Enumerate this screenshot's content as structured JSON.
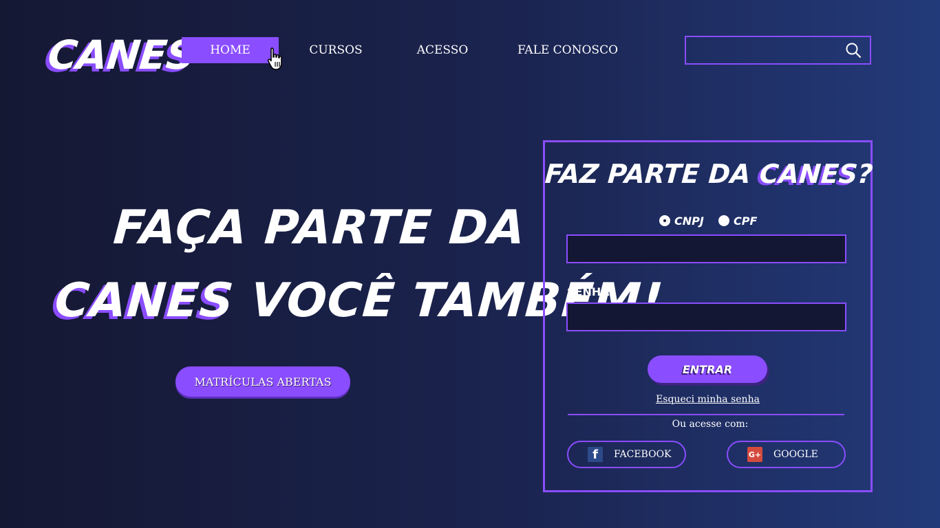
{
  "brand": {
    "logo": "CANES"
  },
  "nav": {
    "items": [
      {
        "label": "HOME",
        "active": true
      },
      {
        "label": "CURSOS"
      },
      {
        "label": "ACESSO"
      },
      {
        "label": "FALE CONOSCO"
      }
    ]
  },
  "search": {
    "value": "",
    "icon": "search-icon"
  },
  "hero": {
    "line1": "FAÇA PARTE DA",
    "brand_word": "CANES",
    "line2_rest": " VOCÊ TAMBÉM!",
    "cta_label": "MATRÍCULAS ABERTAS"
  },
  "login": {
    "title_prefix": "FAZ PARTE DA ",
    "title_brand": "CANES",
    "title_suffix": "?",
    "radio_options": [
      {
        "label": "CNPJ",
        "checked": true
      },
      {
        "label": "CPF",
        "checked": false
      }
    ],
    "id_value": "",
    "password_label": "SENHA:",
    "password_value": "",
    "submit_label": "ENTRAR",
    "forgot_label": "Esqueci minha senha",
    "or_text": "Ou acesse com:",
    "social": [
      {
        "label": "FACEBOOK",
        "icon": "facebook-icon"
      },
      {
        "label": "GOOGLE",
        "icon": "google-plus-icon"
      }
    ]
  },
  "colors": {
    "accent": "#8a4dff",
    "bg_start": "#151833",
    "bg_end": "#233a7a"
  }
}
